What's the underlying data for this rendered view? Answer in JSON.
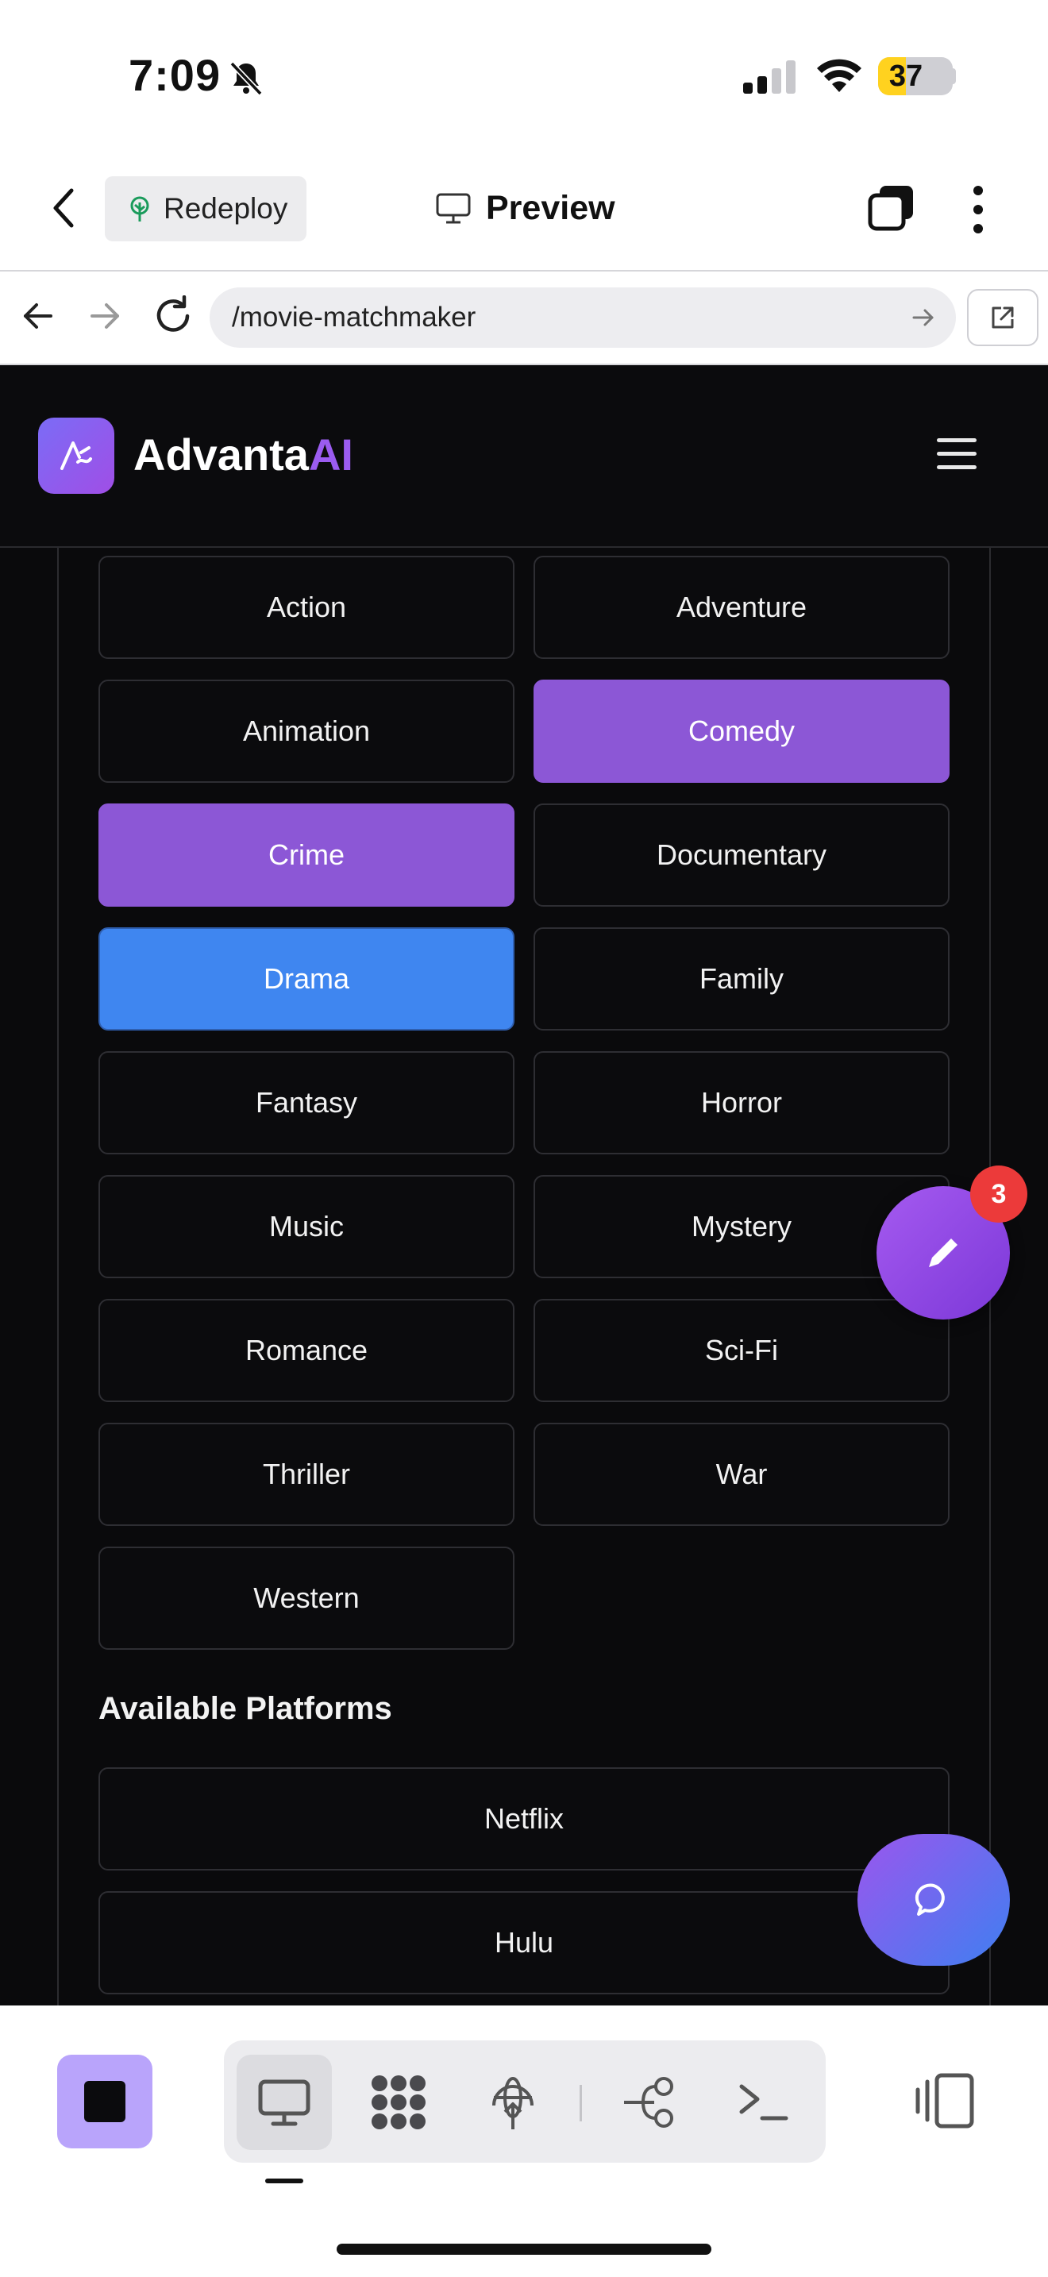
{
  "status_bar": {
    "time": "7:09",
    "battery": "37",
    "battery_level": 0.37
  },
  "app_header": {
    "redeploy_label": "Redeploy",
    "preview_label": "Preview"
  },
  "browser": {
    "url": "/movie-matchmaker"
  },
  "site": {
    "brand_main": "Advanta",
    "brand_accent": "AI"
  },
  "genres": {
    "items": [
      {
        "label": "Action",
        "selected": false
      },
      {
        "label": "Adventure",
        "selected": false
      },
      {
        "label": "Animation",
        "selected": false
      },
      {
        "label": "Comedy",
        "selected": true
      },
      {
        "label": "Crime",
        "selected": true
      },
      {
        "label": "Documentary",
        "selected": false
      },
      {
        "label": "Drama",
        "selected": false,
        "focused": true
      },
      {
        "label": "Family",
        "selected": false
      },
      {
        "label": "Fantasy",
        "selected": false
      },
      {
        "label": "Horror",
        "selected": false
      },
      {
        "label": "Music",
        "selected": false
      },
      {
        "label": "Mystery",
        "selected": false
      },
      {
        "label": "Romance",
        "selected": false
      },
      {
        "label": "Sci-Fi",
        "selected": false
      },
      {
        "label": "Thriller",
        "selected": false
      },
      {
        "label": "War",
        "selected": false
      },
      {
        "label": "Western",
        "selected": false
      }
    ]
  },
  "platforms": {
    "title": "Available Platforms",
    "items": [
      {
        "label": "Netflix"
      },
      {
        "label": "Hulu"
      }
    ]
  },
  "fab": {
    "badge_count": "3"
  },
  "colors": {
    "accent_purple": "#8c57d6",
    "accent_blue": "#3f86f0",
    "badge_red": "#ec3a3a"
  },
  "icons": {
    "bottom_tools": [
      "monitor-icon",
      "apps-grid-icon",
      "deploy-globe-icon",
      "git-branch-icon",
      "terminal-icon"
    ]
  }
}
